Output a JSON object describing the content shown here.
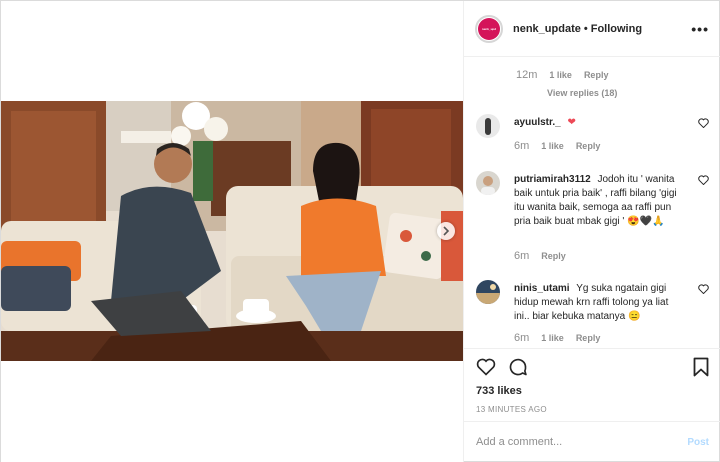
{
  "header": {
    "username": "nenk_update",
    "separator": "•",
    "follow_status": "Following",
    "more_label": "•••",
    "avatar_text": "nenk_upd"
  },
  "comments": {
    "first_meta": {
      "time": "12m",
      "likes": "1 like",
      "reply": "Reply"
    },
    "view_replies": "View replies (18)",
    "items": [
      {
        "user": "ayuulstr._",
        "text": "",
        "emoji": "❤",
        "time": "6m",
        "likes": "1 like",
        "reply": "Reply"
      },
      {
        "user": "putriamirah3112",
        "text": "Jodoh itu ' wanita baik untuk pria baik' , raffi bilang 'gigi itu wanita baik, semoga aa raffi pun pria baik buat mbak gigi '",
        "emoji": "😍🖤🙏",
        "time": "6m",
        "likes": "",
        "reply": "Reply"
      },
      {
        "user": "ninis_utami",
        "text": "Yg suka ngatain gigi hidup mewah krn raffi tolong ya liat ini.. biar kebuka matanya",
        "emoji": "😑",
        "time": "6m",
        "likes": "1 like",
        "reply": "Reply"
      }
    ]
  },
  "actions": {
    "likes": "733 likes",
    "posted": "13 MINUTES AGO"
  },
  "add_comment": {
    "placeholder": "Add a comment...",
    "post_label": "Post"
  },
  "icons": {
    "heart": "heart-icon",
    "comment": "comment-bubble-icon",
    "save": "bookmark-icon",
    "next": "chevron-right-icon"
  },
  "colors": {
    "accent_heart": "#ed4956",
    "muted": "#8e8e8e",
    "post_disabled": "#b3dbff",
    "brand_avatar": "#d4145a"
  }
}
